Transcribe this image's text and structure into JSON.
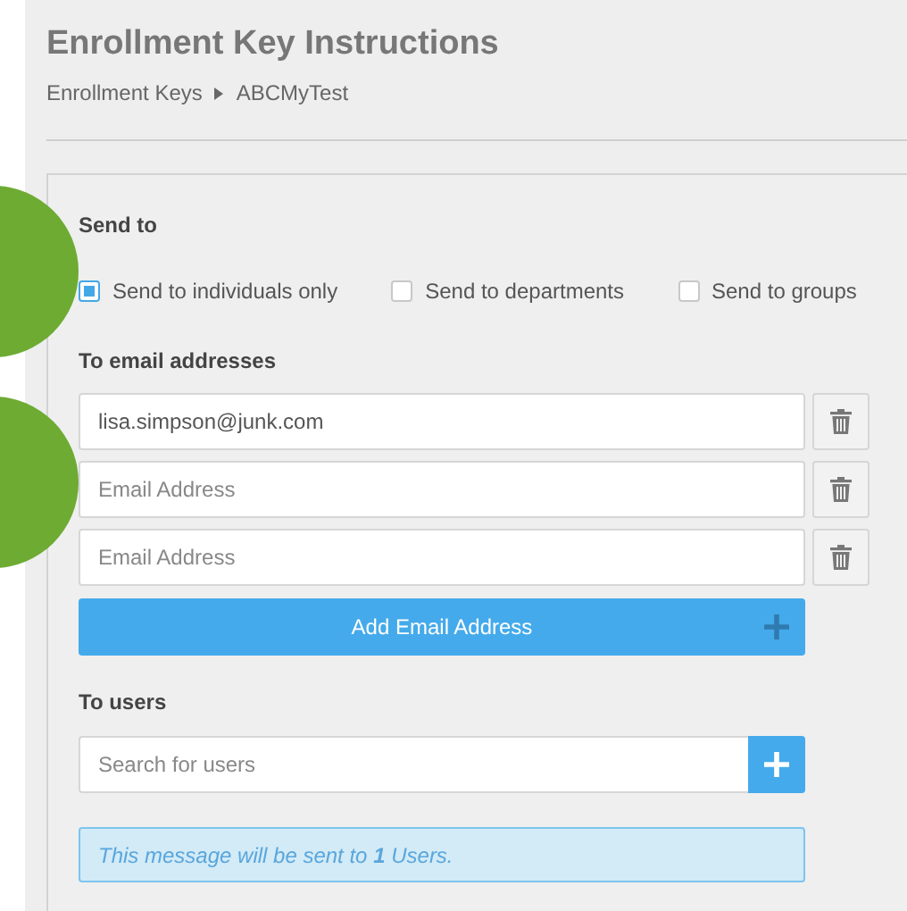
{
  "header": {
    "title": "Enrollment Key Instructions",
    "breadcrumb": [
      {
        "label": "Enrollment Keys"
      },
      {
        "label": "ABCMyTest"
      }
    ]
  },
  "send_to": {
    "label": "Send to",
    "options": [
      {
        "label": "Send to individuals only",
        "checked": true
      },
      {
        "label": "Send to departments",
        "checked": false
      },
      {
        "label": "Send to groups",
        "checked": false
      }
    ]
  },
  "email": {
    "label": "To email addresses",
    "rows": [
      {
        "value": "lisa.simpson@junk.com"
      },
      {
        "placeholder": "Email Address"
      },
      {
        "placeholder": "Email Address"
      }
    ],
    "add_button": "Add Email Address"
  },
  "users": {
    "label": "To users",
    "search": {
      "placeholder": "Search for users"
    }
  },
  "info": "This message will be sent to **1** Users."
}
